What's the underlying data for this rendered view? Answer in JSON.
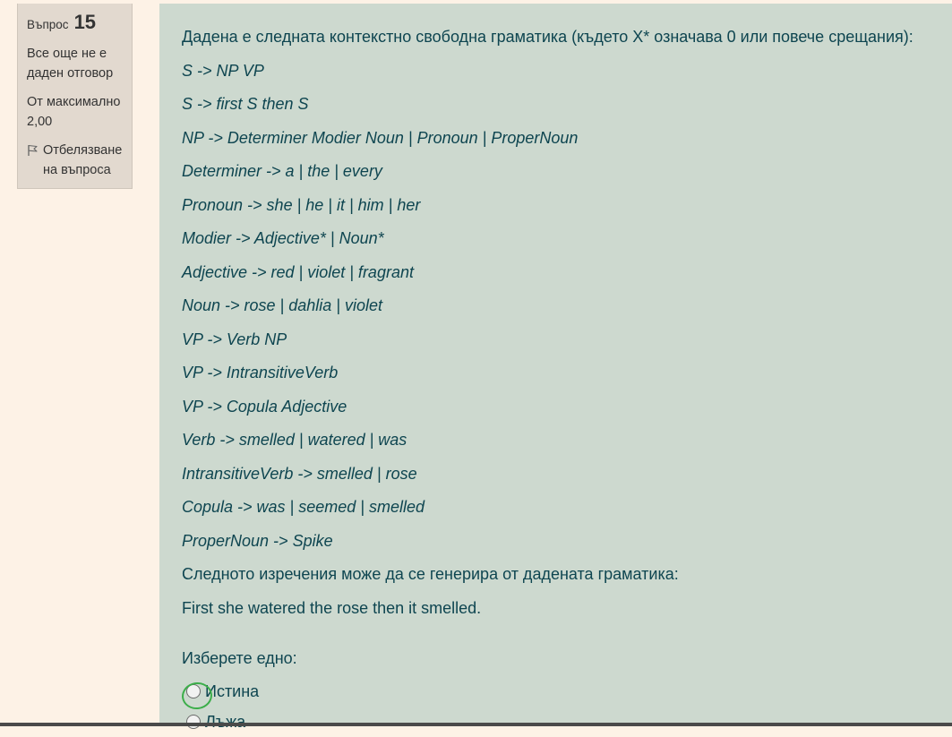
{
  "question_info": {
    "label": "Въпрос",
    "number": "15",
    "state": "Все още не е даден отговор",
    "grade": "От максимално 2,00",
    "flag_label": "Отбелязване на въпроса",
    "flag_icon": "flag-icon"
  },
  "question": {
    "intro": "Дадена е следната контекстно свободна граматика (където X* означава 0 или повече срещания):",
    "rules": [
      "S -> NP VP",
      "S -> first S then S",
      "NP -> Determiner Modier Noun | Pronoun | ProperNoun",
      "Determiner -> a | the | every",
      "Pronoun -> she | he | it | him | her",
      "Modier -> Adjective* | Noun*",
      "Adjective -> red | violet | fragrant",
      "Noun -> rose | dahlia | violet",
      "VP -> Verb NP",
      "VP -> IntransitiveVerb",
      "VP -> Copula Adjective",
      "Verb -> smelled | watered | was",
      "IntransitiveVerb -> smelled | rose",
      "Copula -> was | seemed | smelled",
      "ProperNoun -> Spike"
    ],
    "statement_intro": "Следното изречения може да се генерира от дадената граматика:",
    "sentence": "First she watered the rose then it smelled.",
    "prompt": "Изберете едно:",
    "options": [
      {
        "label": "Истина"
      },
      {
        "label": "Лъжа"
      }
    ]
  },
  "colors": {
    "page_bg": "#fdf2e6",
    "info_bg": "#e2d9cf",
    "content_bg": "#cdd9cf",
    "text": "#0e4550",
    "highlight": "#3cae4a"
  }
}
